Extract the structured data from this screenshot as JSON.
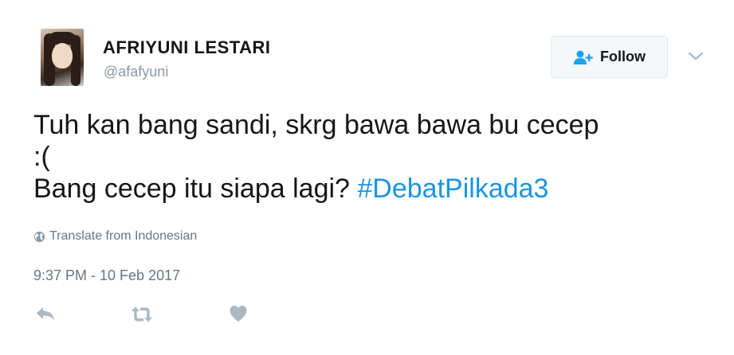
{
  "user": {
    "display_name": "AFRIYUNI LESTARI",
    "handle": "@afafyuni"
  },
  "follow_button": {
    "label": "Follow",
    "icon": "add-user-icon"
  },
  "menu": {
    "icon": "chevron-down-icon"
  },
  "tweet": {
    "line1": "Tuh kan bang sandi, skrg bawa bawa bu cecep",
    "line2": ":(",
    "line3_text": "Bang cecep itu siapa lagi? ",
    "hashtag": "#DebatPilkada3"
  },
  "translate": {
    "label": "Translate from Indonesian",
    "icon": "globe-icon"
  },
  "timestamp": "9:37 PM - 10 Feb 2017",
  "actions": {
    "reply_icon": "reply-icon",
    "retweet_icon": "retweet-icon",
    "like_icon": "heart-icon"
  },
  "colors": {
    "text": "#14171a",
    "muted": "#657786",
    "handle": "#8899a6",
    "link": "#1b95e0",
    "follow_icon": "#1da1f2",
    "action_icon": "#aab8c2"
  }
}
